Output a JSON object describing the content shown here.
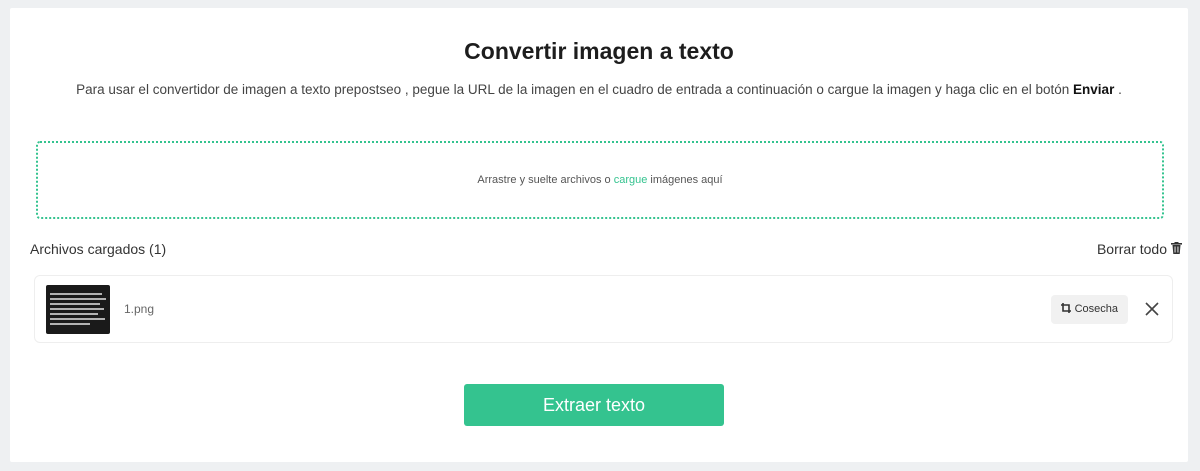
{
  "header": {
    "title": "Convertir imagen a texto",
    "description_part1": "Para usar el convertidor de imagen a texto prepostseo , pegue la URL de la imagen en el cuadro de entrada a continuación o cargue la imagen y haga clic en el botón ",
    "description_bold": "Enviar",
    "description_part2": " ."
  },
  "dropzone": {
    "text_before": "Arrastre y suelte archivos o ",
    "link_text": "cargue",
    "text_after": " imágenes aquí"
  },
  "files": {
    "heading": "Archivos cargados (1)",
    "clear_all_label": "Borrar todo",
    "clear_all_icon": "trash-icon",
    "items": [
      {
        "name": "1.png",
        "crop_label": "Cosecha",
        "crop_icon": "crop-icon",
        "remove_icon": "close-icon"
      }
    ]
  },
  "actions": {
    "extract_label": "Extraer texto"
  },
  "colors": {
    "accent": "#34c38f",
    "background": "#eef0f2",
    "card": "#ffffff"
  }
}
